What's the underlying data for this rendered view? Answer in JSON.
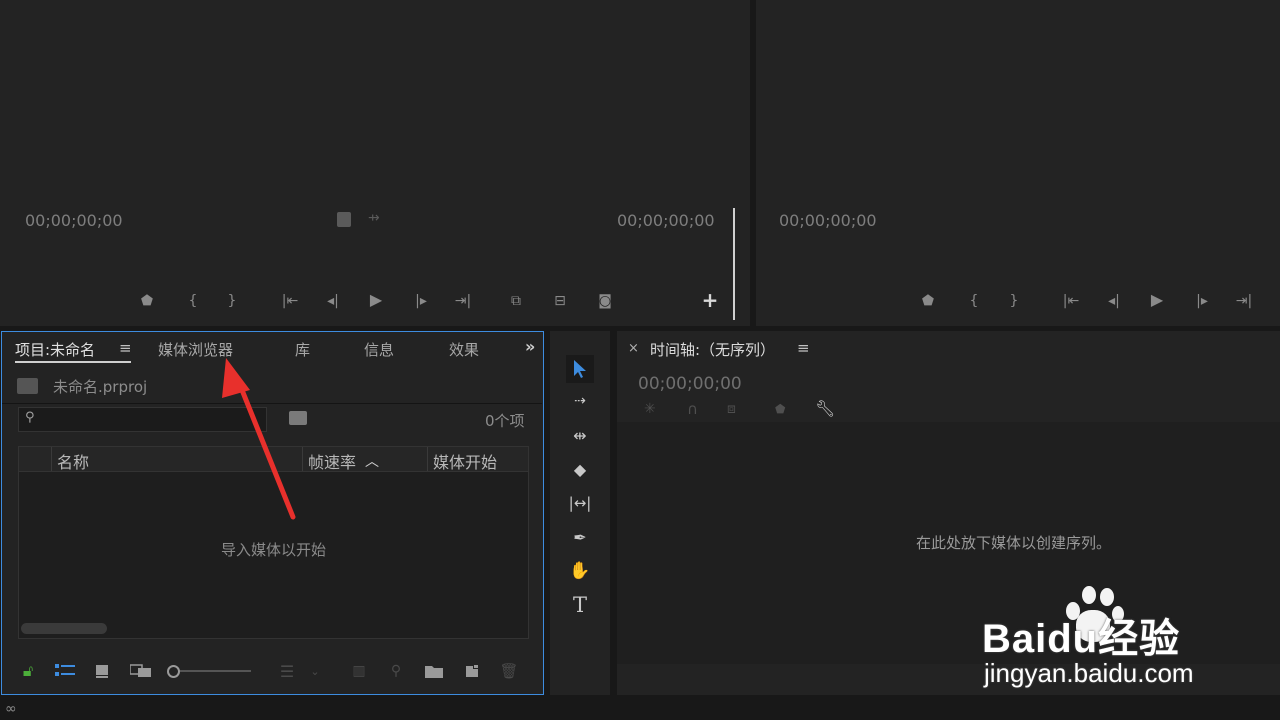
{
  "source_monitor": {
    "timecode_left": "00;00;00;00",
    "timecode_right": "00;00;00;00"
  },
  "program_monitor": {
    "timecode_left": "00;00;00;00"
  },
  "project_panel": {
    "tabs": [
      {
        "label": "项目:未命名"
      },
      {
        "label": "媒体浏览器"
      },
      {
        "label": "库"
      },
      {
        "label": "信息"
      },
      {
        "label": "效果"
      }
    ],
    "file_name": "未命名.prproj",
    "search": {
      "value": "",
      "placeholder": ""
    },
    "item_count": "0个项",
    "columns": {
      "name": "名称",
      "frame_rate": "帧速率",
      "media_start": "媒体开始"
    },
    "empty_message": "导入媒体以开始"
  },
  "timeline_panel": {
    "title": "时间轴:（无序列）",
    "timecode": "00;00;00;00",
    "empty_message": "在此处放下媒体以创建序列。"
  },
  "watermark": {
    "brand": "Baidu经验",
    "url": "jingyan.baidu.com"
  },
  "colors": {
    "accent_blue": "#3d8cdf",
    "arrow_red": "#e8302c",
    "lock_green": "#4caf3a"
  }
}
